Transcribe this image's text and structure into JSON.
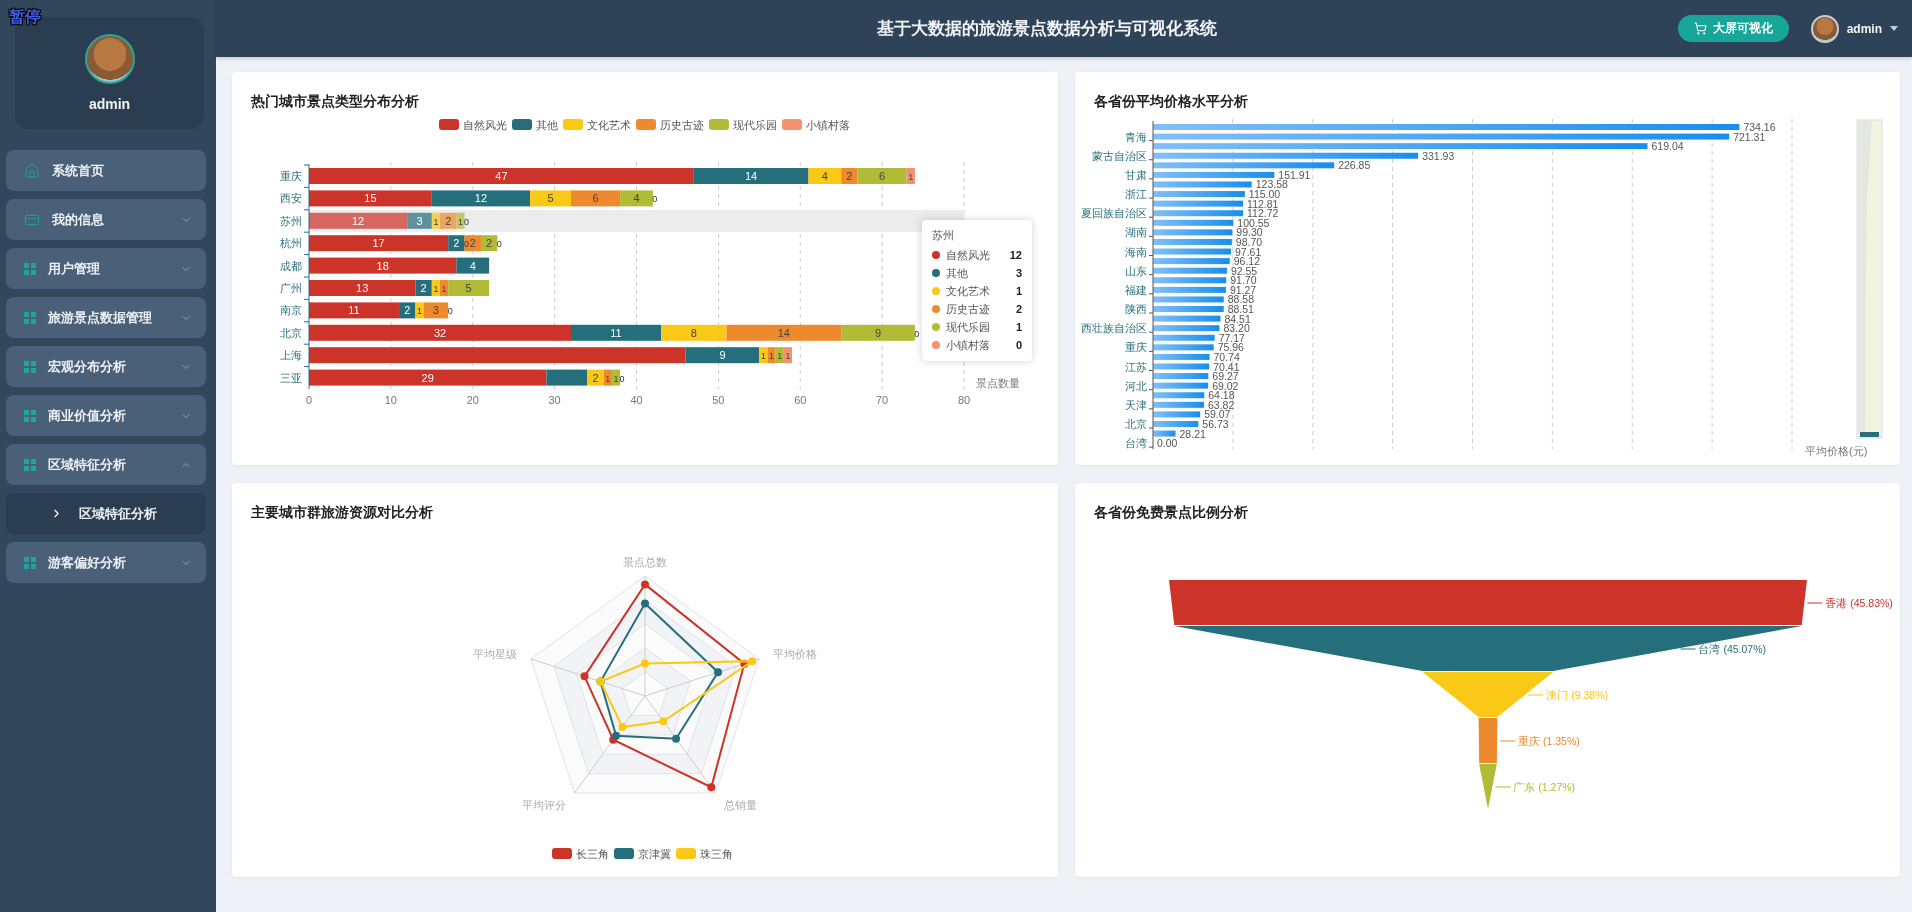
{
  "overlay": {
    "label": "暂停"
  },
  "sidebar": {
    "user": {
      "name": "admin"
    },
    "menu": [
      {
        "label": "系统首页",
        "kind": "home"
      },
      {
        "label": "我的信息",
        "kind": "card",
        "expanded": false
      },
      {
        "label": "用户管理",
        "kind": "grid",
        "expanded": false
      },
      {
        "label": "旅游景点数据管理",
        "kind": "grid",
        "expanded": false
      },
      {
        "label": "宏观分布分析",
        "kind": "grid",
        "expanded": false
      },
      {
        "label": "商业价值分析",
        "kind": "grid",
        "expanded": false
      },
      {
        "label": "区域特征分析",
        "kind": "grid",
        "expanded": true,
        "children": [
          {
            "label": "区域特征分析"
          }
        ]
      },
      {
        "label": "游客偏好分析",
        "kind": "grid",
        "expanded": false
      }
    ]
  },
  "header": {
    "title": "基于大数据的旅游景点数据分析与可视化系统",
    "button": "大屏可视化",
    "user": {
      "name": "admin"
    }
  },
  "panels": [
    {
      "kind": "stacked",
      "title": "热门城市景点类型分布分析",
      "chart_data": {
        "type": "bar",
        "orientation": "horizontal",
        "stacked": true,
        "grid": true,
        "legend": "top",
        "xlabel": "景点数量",
        "xlim": [
          0,
          80
        ],
        "xticks": [
          0,
          10,
          20,
          30,
          40,
          50,
          60,
          70,
          80
        ],
        "categories": [
          "重庆",
          "西安",
          "苏州",
          "杭州",
          "成都",
          "广州",
          "南京",
          "北京",
          "上海",
          "三亚"
        ],
        "series": [
          {
            "name": "自然风光",
            "color": "#cc3329",
            "values": [
              47,
              15,
              12,
              17,
              18,
              13,
              11,
              32,
              46,
              29
            ]
          },
          {
            "name": "其他",
            "color": "#256f7d",
            "values": [
              14,
              12,
              3,
              2,
              4,
              2,
              2,
              11,
              9,
              5
            ]
          },
          {
            "name": "文化艺术",
            "color": "#fac816",
            "values": [
              4,
              5,
              1,
              0,
              null,
              1,
              1,
              8,
              1,
              2
            ]
          },
          {
            "name": "历史古迹",
            "color": "#ee8a2d",
            "values": [
              2,
              6,
              2,
              2,
              null,
              1,
              3,
              14,
              1,
              1
            ]
          },
          {
            "name": "现代乐园",
            "color": "#b1bb35",
            "values": [
              6,
              4,
              1,
              2,
              null,
              5,
              0,
              9,
              1,
              1
            ]
          },
          {
            "name": "小镇村落",
            "color": "#f6916f",
            "values": [
              1,
              0,
              0,
              0,
              null,
              null,
              0,
              0,
              1,
              0
            ]
          }
        ],
        "value_labels": [
          [
            "47",
            "15",
            "12",
            "17",
            "18",
            "13",
            "11",
            "32",
            null,
            "29"
          ],
          [
            "14",
            "12",
            "3",
            "2",
            "4",
            "2",
            "2",
            "11",
            "9",
            null
          ],
          [
            "4",
            "5",
            "1",
            "0",
            null,
            "1",
            "1",
            "8",
            "1",
            "2"
          ],
          [
            "2",
            "6",
            "2",
            "2",
            null,
            "1",
            "3",
            "14",
            "1",
            "1"
          ],
          [
            "6",
            "4",
            "1",
            "2",
            null,
            "5",
            "0",
            "9",
            "1",
            "1"
          ],
          [
            "1",
            "0",
            "0",
            "0",
            null,
            null,
            null,
            "0",
            "1",
            "0"
          ]
        ]
      },
      "hover": [
        false,
        false,
        true,
        false,
        false,
        false,
        false,
        false,
        false,
        false
      ],
      "tooltip": {
        "title": "苏州",
        "rows": [
          {
            "name": "自然风光",
            "value": "12",
            "color": "#cc3329"
          },
          {
            "name": "其他",
            "value": "3",
            "color": "#256f7d"
          },
          {
            "name": "文化艺术",
            "value": "1",
            "color": "#fac816"
          },
          {
            "name": "历史古迹",
            "value": "2",
            "color": "#ee8a2d"
          },
          {
            "name": "现代乐园",
            "value": "1",
            "color": "#b1bb35"
          },
          {
            "name": "小镇村落",
            "value": "0",
            "color": "#f6916f"
          }
        ]
      }
    },
    {
      "kind": "bars",
      "title": "各省份平均价格水平分析",
      "chart_data": {
        "type": "bar",
        "orientation": "horizontal",
        "grid": true,
        "xlabel": "平均价格(元)",
        "xlim": [
          0,
          800
        ],
        "categories": [
          null,
          "青海",
          null,
          "蒙古自治区",
          null,
          "甘肃",
          null,
          "浙江",
          null,
          "夏回族自治区",
          null,
          "湖南",
          null,
          "海南",
          null,
          "山东",
          null,
          "福建",
          null,
          "陕西",
          null,
          "西壮族自治区",
          null,
          "重庆",
          null,
          "江苏",
          null,
          "河北",
          null,
          "天津",
          null,
          "北京",
          null,
          "台湾"
        ],
        "values": [
          734.16,
          721.31,
          619.04,
          331.93,
          226.85,
          151.91,
          123.58,
          115.0,
          112.81,
          112.72,
          100.55,
          99.3,
          98.7,
          97.61,
          96.12,
          92.55,
          91.7,
          91.27,
          88.58,
          88.51,
          84.51,
          83.2,
          77.17,
          75.96,
          70.74,
          70.41,
          69.27,
          69.02,
          64.18,
          63.82,
          59.07,
          56.73,
          28.21,
          0.0
        ],
        "value_labels": [
          "734.16",
          "721.31",
          "619.04",
          "331.93",
          "226.85",
          "151.91",
          "123.58",
          "115.00",
          "112.81",
          "112.72",
          "100.55",
          "99.30",
          "98.70",
          "97.61",
          "96.12",
          "92.55",
          "91.70",
          "91.27",
          "88.58",
          "88.51",
          "84.51",
          "83.20",
          "77.17",
          "75.96",
          "70.74",
          "70.41",
          "69.27",
          "69.02",
          "64.18",
          "63.82",
          "59.07",
          "56.73",
          "28.21",
          "0.00"
        ]
      }
    },
    {
      "kind": "radar",
      "title": "主要城市群旅游资源对比分析",
      "radar": {
        "indicators": [
          "景点总数",
          "平均价格",
          "总销量",
          "平均评分",
          "平均星级"
        ],
        "legend": [
          {
            "name": "长三角",
            "color": "#cc3329"
          },
          {
            "name": "京津冀",
            "color": "#256f7d"
          },
          {
            "name": "珠三角",
            "color": "#fac816"
          }
        ]
      }
    },
    {
      "kind": "funnel",
      "title": "各省份免费景点比例分析",
      "funnel": [
        {
          "label": "香港 (45.83%)",
          "color": "#cc3329"
        },
        {
          "label": "台湾 (45.07%)",
          "color": "#256f7d"
        },
        {
          "label": "澳门 (9.38%)",
          "color": "#fac816"
        },
        {
          "label": "重庆 (1.35%)",
          "color": "#ee8a2d"
        },
        {
          "label": "广东 (1.27%)",
          "color": "#b1bb35"
        }
      ]
    }
  ]
}
